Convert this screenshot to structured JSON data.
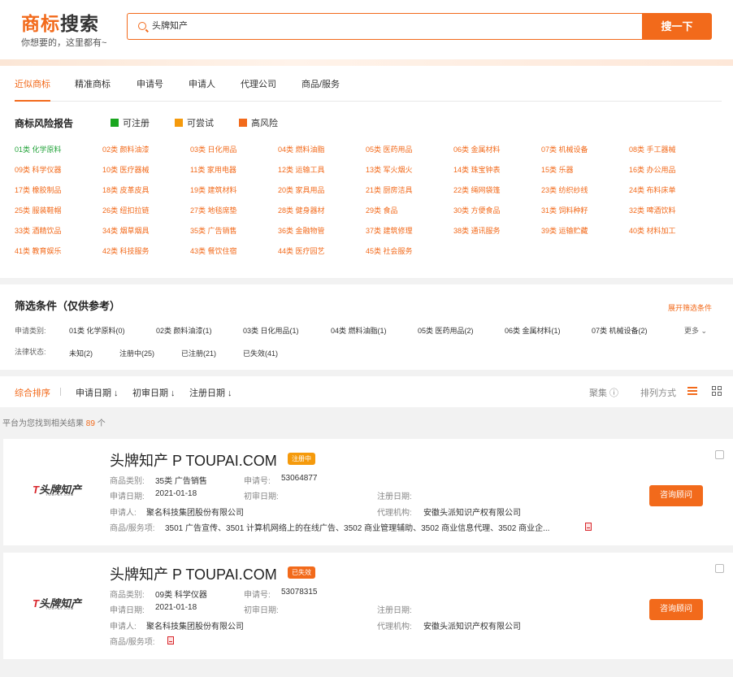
{
  "header": {
    "title_a": "商标",
    "title_b": "搜索",
    "subtitle": "你想要的，这里都有~",
    "search_value": "头牌知产",
    "search_button": "搜一下"
  },
  "tabs": [
    "近似商标",
    "精准商标",
    "申请号",
    "申请人",
    "代理公司",
    "商品/服务"
  ],
  "risk": {
    "title": "商标风险报告",
    "legend": [
      {
        "label": "可注册",
        "color": "#1aa61f"
      },
      {
        "label": "可尝试",
        "color": "#f59a0c"
      },
      {
        "label": "高风险",
        "color": "#f26a1b"
      }
    ]
  },
  "classes": [
    "01类 化学原料",
    "02类 颜料油漆",
    "03类 日化用品",
    "04类 燃料油脂",
    "05类 医药用品",
    "06类 金属材料",
    "07类 机械设备",
    "08类 手工器械",
    "09类 科学仪器",
    "10类 医疗器械",
    "11类 家用电器",
    "12类 运输工具",
    "13类 军火烟火",
    "14类 珠宝钟表",
    "15类 乐器",
    "16类 办公用品",
    "17类 橡胶制品",
    "18类 皮革皮具",
    "19类 建筑材料",
    "20类 家具用品",
    "21类 厨房洁具",
    "22类 绳网袋篷",
    "23类 纺织纱线",
    "24类 布料床单",
    "25类 服装鞋帽",
    "26类 纽扣拉链",
    "27类 地毯席垫",
    "28类 健身器材",
    "29类 食品",
    "30类 方便食品",
    "31类 饲料种籽",
    "32类 啤酒饮料",
    "33类 酒精饮品",
    "34类 烟草烟具",
    "35类 广告销售",
    "36类 金融物管",
    "37类 建筑修理",
    "38类 通讯服务",
    "39类 运输贮藏",
    "40类 材料加工",
    "41类 教育娱乐",
    "42类 科技服务",
    "43类 餐饮住宿",
    "44类 医疗园艺",
    "45类 社会服务"
  ],
  "filter": {
    "title": "筛选条件（仅供参考）",
    "expand": "展开筛选条件",
    "class_label": "申请类别:",
    "class_options": [
      "01类 化学原料(0)",
      "02类 颜料油漆(1)",
      "03类 日化用品(1)",
      "04类 燃料油脂(1)",
      "05类 医药用品(2)",
      "06类 金属材料(1)",
      "07类 机械设备(2)"
    ],
    "more": "更多",
    "status_label": "法律状态:",
    "status_options": [
      "未知(2)",
      "注册中(25)",
      "已注册(21)",
      "已失效(41)"
    ]
  },
  "sort": {
    "items": [
      "综合排序",
      "申请日期 ↓",
      "初审日期 ↓",
      "注册日期 ↓"
    ],
    "cluster": "聚集 ⓘ",
    "mode": "排列方式"
  },
  "result": {
    "prefix": "平台为您找到相关结果",
    "count": "89",
    "suffix": "个"
  },
  "logo": {
    "mark": "T",
    "text": "头牌知产",
    "sub": "TOUPAI.COM"
  },
  "items": [
    {
      "name": "头牌知产 P TOUPAI.COM",
      "status": "注册中",
      "status_color": "#f59a0c",
      "labels": {
        "cat": "商品类别:",
        "appno": "申请号:",
        "appdate": "申请日期:",
        "first": "初审日期:",
        "reg": "注册日期:",
        "applicant": "申请人:",
        "agent": "代理机构:",
        "goods": "商品/服务项:"
      },
      "cat": "35类 广告销售",
      "appno": "53064877",
      "appdate": "2021-01-18",
      "applicant": "聚名科技集团股份有限公司",
      "agent": "安徽头派知识产权有限公司",
      "goods": "3501 广告宣传、3501 计算机网络上的在线广告、3502 商业管理辅助、3502 商业信息代理、3502 商业企...",
      "button": "咨询顾问"
    },
    {
      "name": "头牌知产 P TOUPAI.COM",
      "status": "已失效",
      "status_color": "#f26a1b",
      "labels": {
        "cat": "商品类别:",
        "appno": "申请号:",
        "appdate": "申请日期:",
        "first": "初审日期:",
        "reg": "注册日期:",
        "applicant": "申请人:",
        "agent": "代理机构:",
        "goods": "商品/服务项:"
      },
      "cat": "09类 科学仪器",
      "appno": "53078315",
      "appdate": "2021-01-18",
      "applicant": "聚名科技集团股份有限公司",
      "agent": "安徽头派知识产权有限公司",
      "goods": "",
      "button": "咨询顾问"
    }
  ]
}
